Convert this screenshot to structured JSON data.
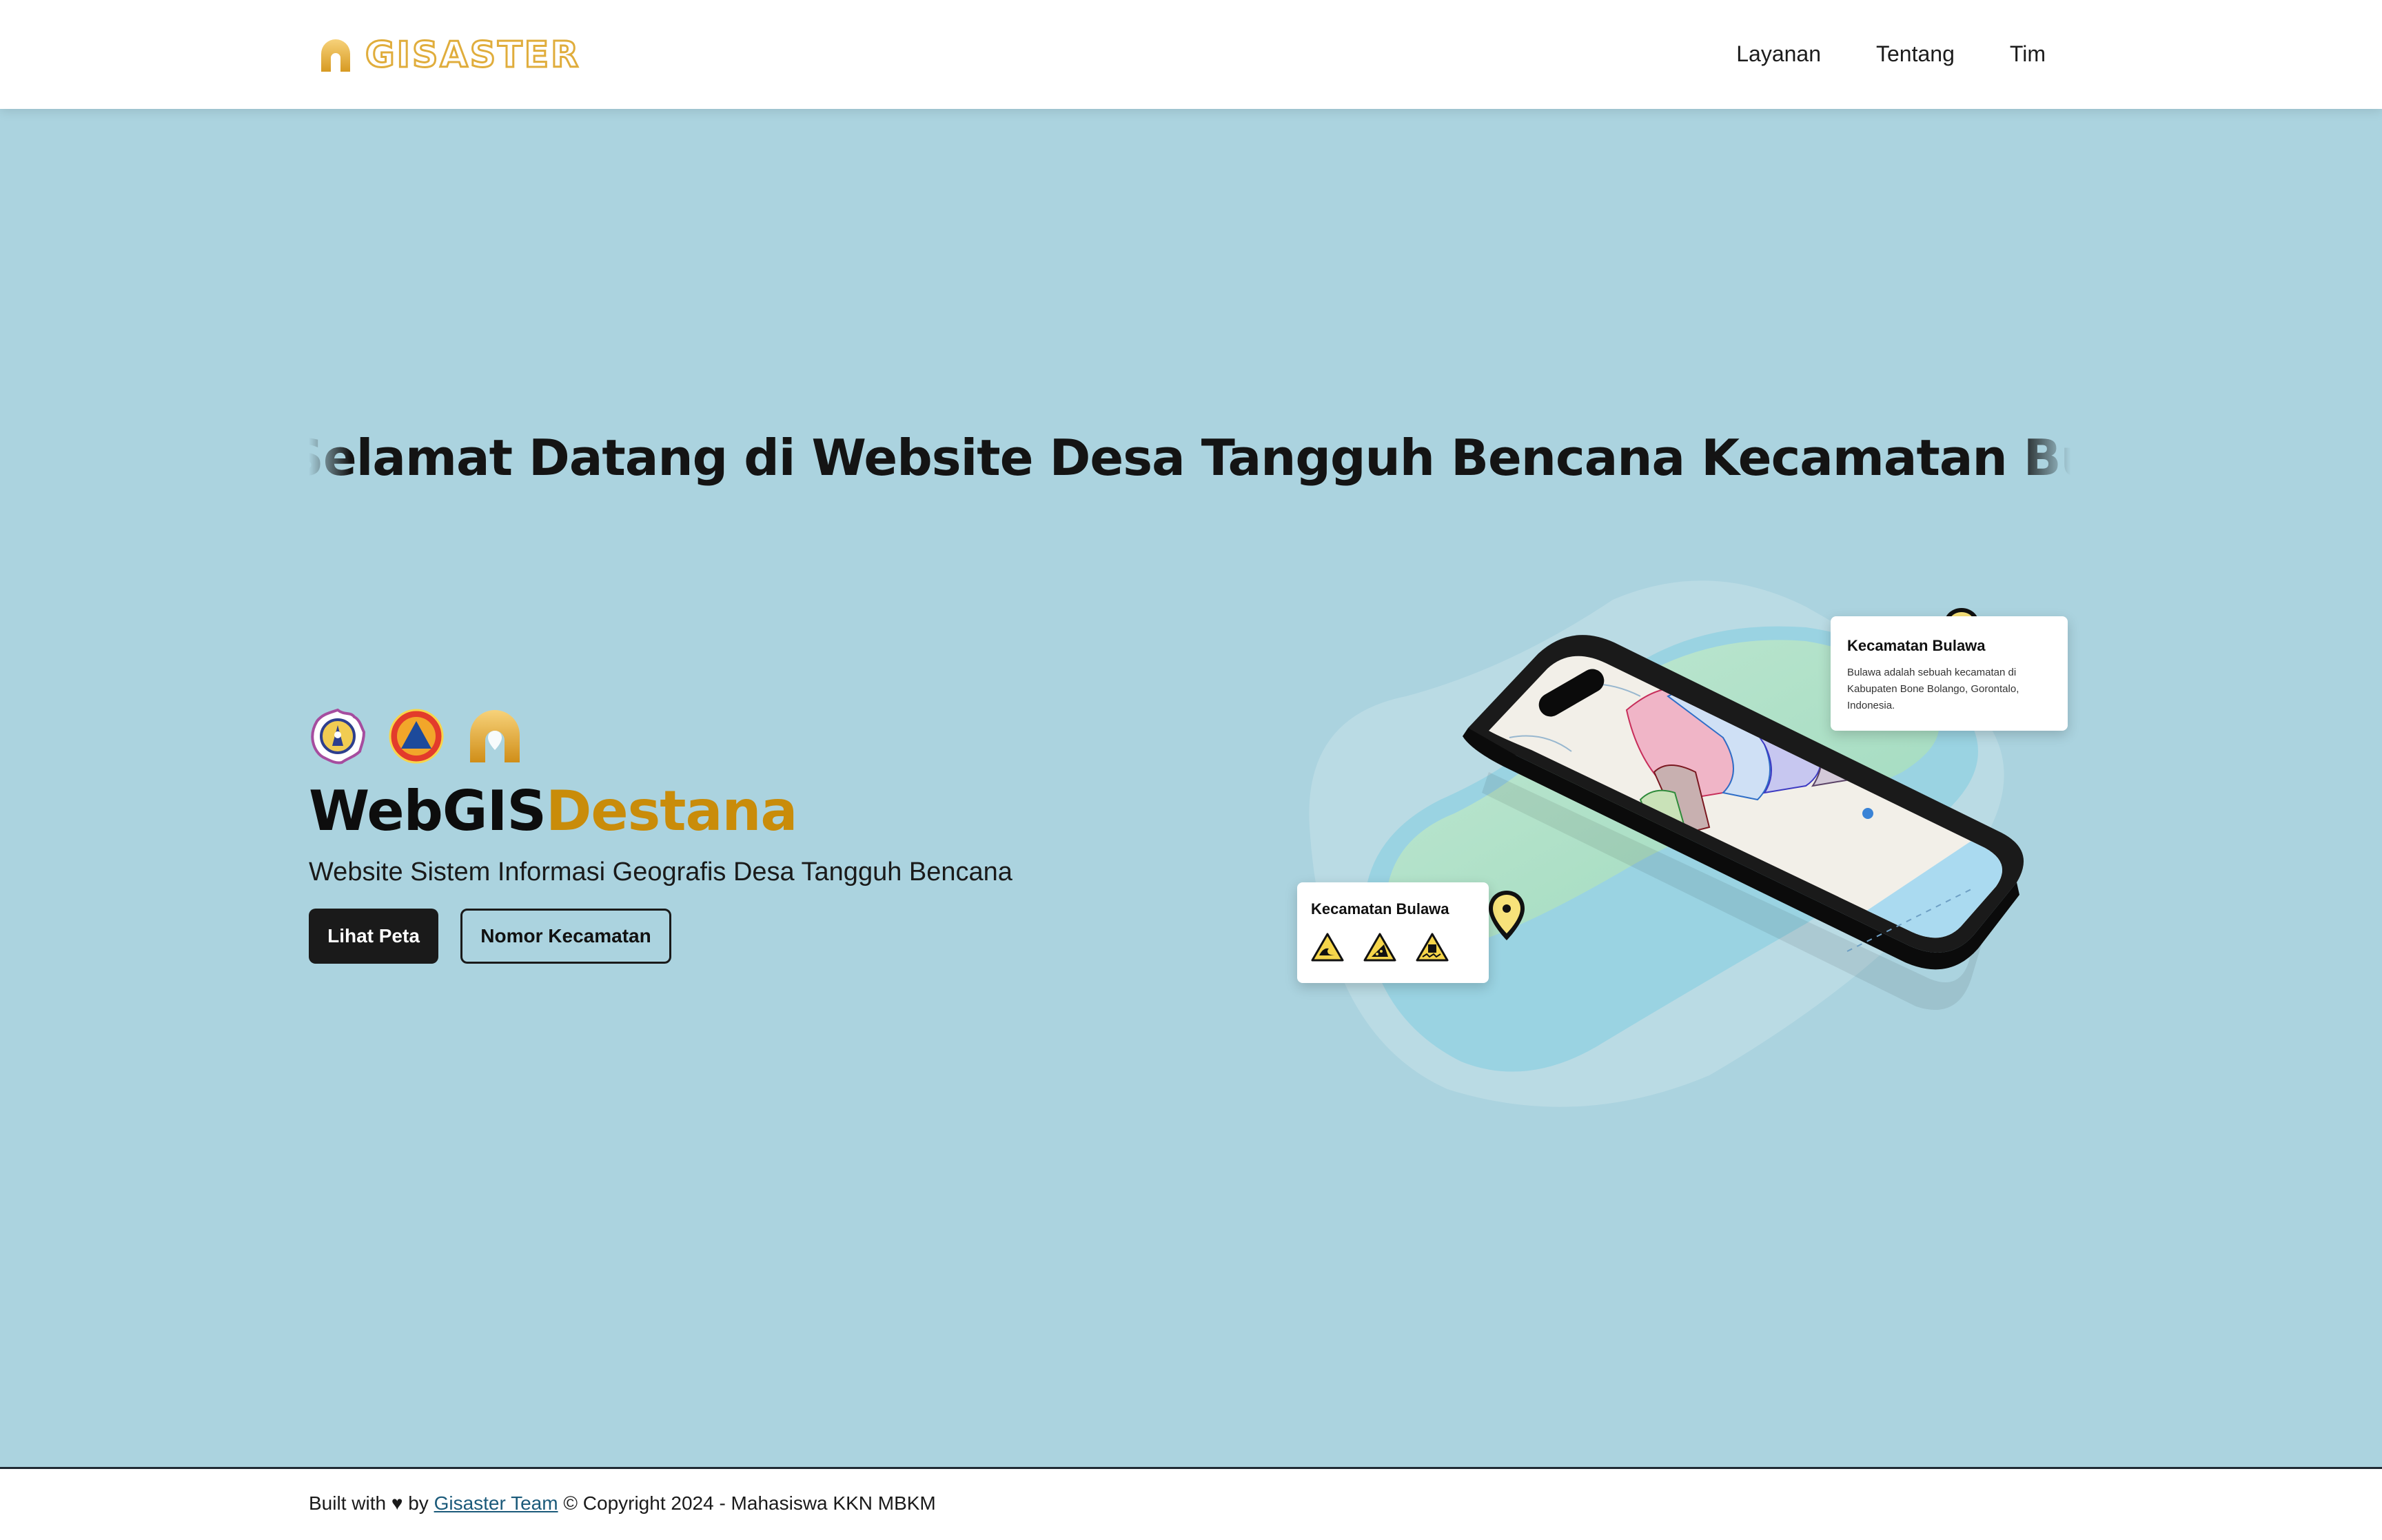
{
  "nav": {
    "brand": "GISASTER",
    "links": [
      "Layanan",
      "Tentang",
      "Tim"
    ]
  },
  "marquee": {
    "text": "Selamat Datang di Website Desa Tangguh Bencana Kecamatan Bulawa Kabupaten Bone Bolango"
  },
  "hero": {
    "title_part1": "WebGIS",
    "title_part2": "Destana",
    "subtitle": "Website Sistem Informasi Geografis Desa Tangguh Bencana",
    "btn_primary": "Lihat Peta",
    "btn_secondary": "Nomor Kecamatan"
  },
  "illustration": {
    "card_top": {
      "title": "Kecamatan Bulawa",
      "desc": "Bulawa adalah sebuah kecamatan di Kabupaten Bone Bolango, Gorontalo, Indonesia."
    },
    "card_bottom": {
      "title": "Kecamatan Bulawa",
      "hazard_icons": [
        "tsunami-icon",
        "landslide-icon",
        "earthquake-icon"
      ]
    }
  },
  "footer": {
    "prefix": "Built with ♥ by",
    "link": "Gisaster Team",
    "suffix": "© Copyright 2024 - Mahasiswa KKN MBKM"
  },
  "colors": {
    "background": "#abd3df",
    "brand_gold": "#e0ad3c",
    "title_accent": "#c98c0a",
    "button_dark": "#1a1a1a"
  }
}
